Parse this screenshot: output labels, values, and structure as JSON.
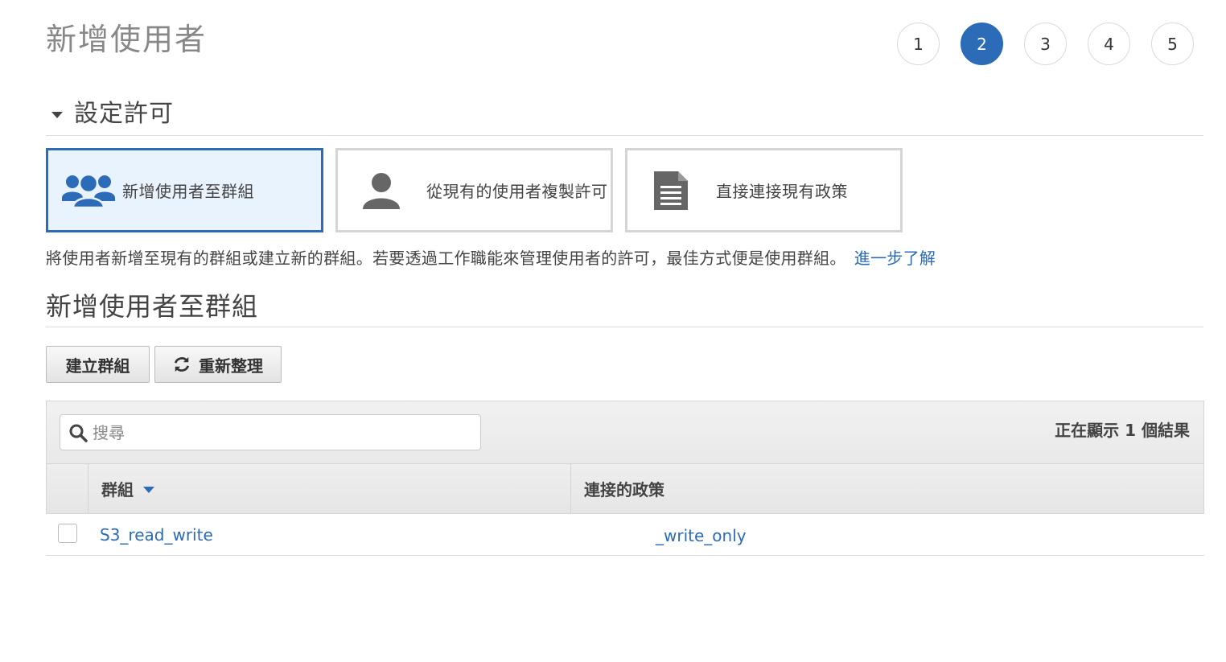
{
  "page": {
    "title": "新增使用者"
  },
  "steps": [
    {
      "label": "1",
      "active": false
    },
    {
      "label": "2",
      "active": true
    },
    {
      "label": "3",
      "active": false
    },
    {
      "label": "4",
      "active": false
    },
    {
      "label": "5",
      "active": false
    }
  ],
  "permissions": {
    "section_title": "設定許可",
    "options": [
      {
        "label": "新增使用者至群組",
        "icon": "users-group-icon",
        "selected": true
      },
      {
        "label": "從現有的使用者複製許可",
        "icon": "user-icon",
        "selected": false
      },
      {
        "label": "直接連接現有政策",
        "icon": "document-icon",
        "selected": false
      }
    ],
    "description": "將使用者新增至現有的群組或建立新的群組。若要透過工作職能來管理使用者的許可，最佳方式便是使用群組。",
    "learn_more": "進一步了解"
  },
  "groups": {
    "title": "新增使用者至群組",
    "create_button": "建立群組",
    "refresh_button": "重新整理",
    "search_placeholder": "搜尋",
    "result_count": "正在顯示 1 個結果",
    "columns": {
      "group": "群組",
      "policies": "連接的政策"
    },
    "rows": [
      {
        "group": "S3_read_write",
        "policy": "_write_only",
        "checked": false
      }
    ]
  },
  "colors": {
    "accent": "#2b6bb8",
    "selected_bg": "#e9f3fd",
    "icon_gray": "#666666"
  }
}
